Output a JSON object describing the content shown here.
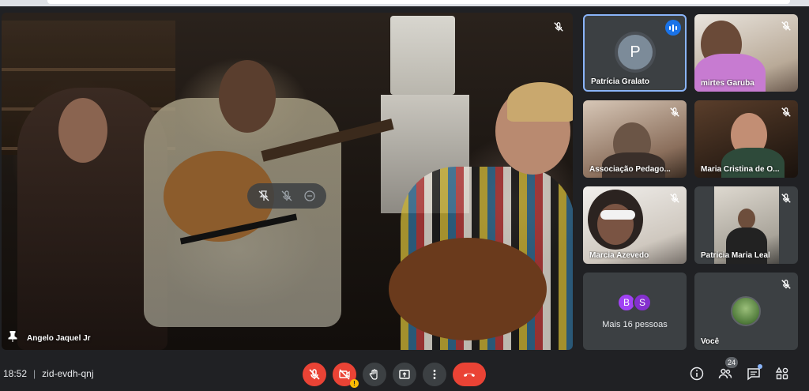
{
  "meeting": {
    "time": "18:52",
    "code": "zid-evdh-qnj"
  },
  "main_tile": {
    "presenter_name": "Angelo Jaquel Jr",
    "pinned": true
  },
  "participants": [
    {
      "name": "Patrícia Gralato",
      "initial": "P",
      "speaking": true,
      "avatar_color": "#7c8b99"
    },
    {
      "name": "mirtes Garuba",
      "muted": true
    },
    {
      "name": "Associação Pedago...",
      "muted": true
    },
    {
      "name": "Maria Cristina de O...",
      "muted": true
    },
    {
      "name": "Marcia Azevedo",
      "muted": true
    },
    {
      "name": "Patricia Maria Leal",
      "muted": true
    }
  ],
  "more_tile": {
    "label": "Mais 16 pessoas",
    "avatars": [
      {
        "initial": "B",
        "color": "#a142f4"
      },
      {
        "initial": "S",
        "color": "#8430ce"
      }
    ]
  },
  "self_tile": {
    "name": "Você",
    "muted": true
  },
  "people_count": "24",
  "colors": {
    "background": "#202124",
    "danger": "#ea4335",
    "accent": "#8ab4f8",
    "speaking": "#1a73e8"
  },
  "icons": {
    "mic": "mic-off-icon",
    "camera": "camera-off-icon",
    "hand": "raise-hand-icon",
    "present": "present-icon",
    "more": "more-options-icon",
    "hangup": "hangup-icon",
    "info": "info-icon",
    "people": "people-icon",
    "chat": "chat-icon",
    "activities": "activities-icon"
  }
}
